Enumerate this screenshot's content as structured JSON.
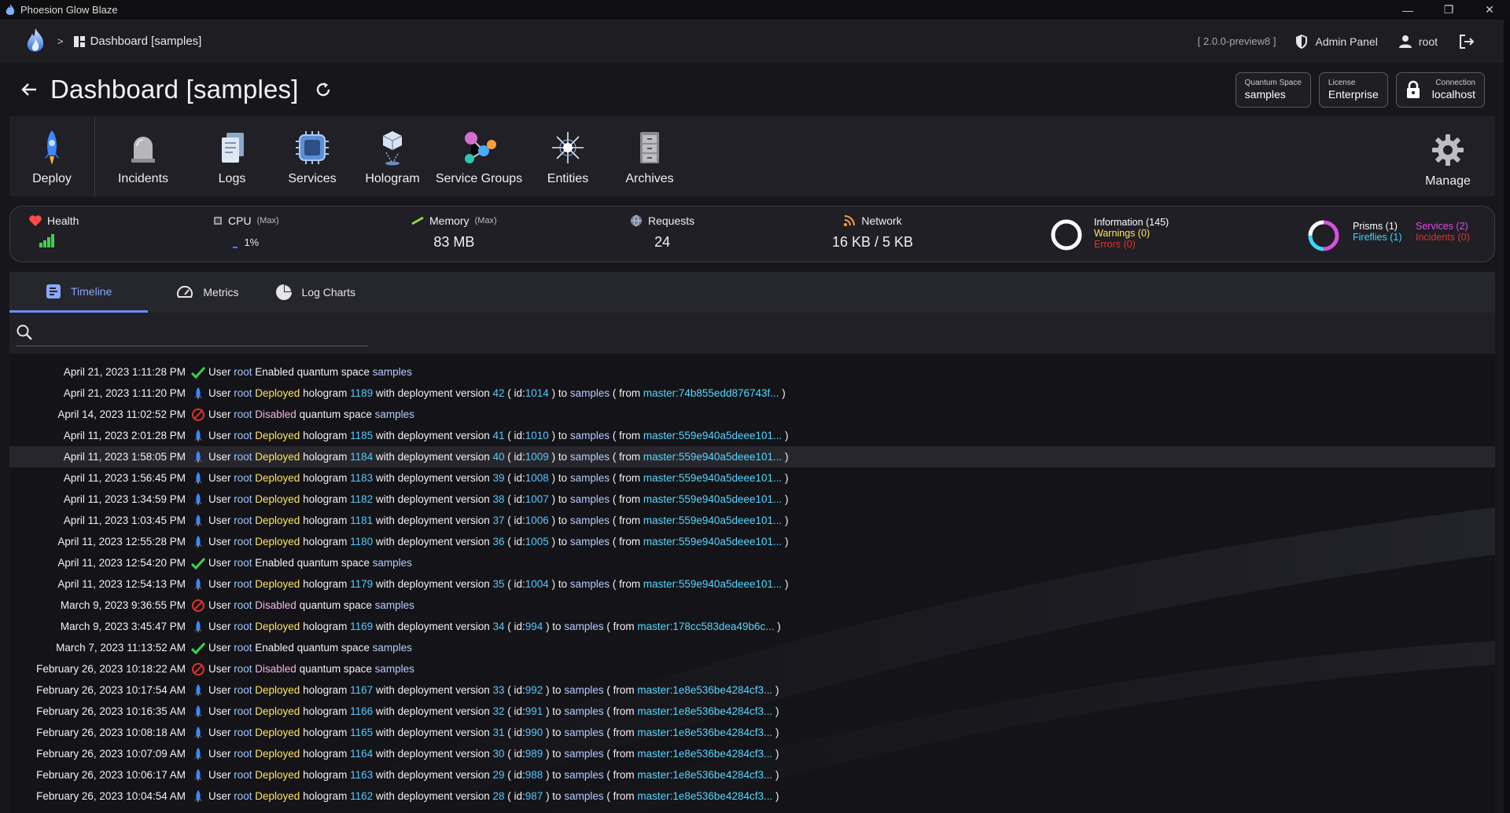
{
  "window": {
    "title": "Phoesion Glow Blaze",
    "minimize": "—",
    "maximize": "❐",
    "close": "✕"
  },
  "topnav": {
    "breadcrumb_sep": ">",
    "breadcrumb": "Dashboard [samples]",
    "version": "[ 2.0.0-preview8 ]",
    "admin_panel": "Admin Panel",
    "user": "root"
  },
  "header": {
    "title": "Dashboard [samples]",
    "chips": {
      "quantum_space_label": "Quantum Space",
      "quantum_space_value": "samples",
      "license_label": "License",
      "license_value": "Enterprise",
      "connection_label": "Connection",
      "connection_value": "localhost"
    }
  },
  "toolbar": {
    "items": [
      "Deploy",
      "Incidents",
      "Logs",
      "Services",
      "Hologram",
      "Service Groups",
      "Entities",
      "Archives"
    ],
    "manage": "Manage"
  },
  "status": {
    "health_label": "Health",
    "cpu_label": "CPU",
    "cpu_sub": "(Max)",
    "cpu_value": "1%",
    "memory_label": "Memory",
    "memory_sub": "(Max)",
    "memory_value": "83 MB",
    "requests_label": "Requests",
    "requests_value": "24",
    "network_label": "Network",
    "network_value": "16 KB / 5 KB",
    "information": "Information (145)",
    "warnings": "Warnings (0)",
    "errors": "Errors (0)",
    "prisms": "Prisms (1)",
    "fireflies": "Fireflies (1)",
    "services": "Services (2)",
    "incidents": "Incidents (0)",
    "colors": {
      "info": "#ffffff",
      "warning": "#ffe45c",
      "error": "#e0302a",
      "prisms": "#ffffff",
      "fireflies": "#3fd6ff",
      "services": "#d84fe0",
      "incidents": "#e0302a"
    }
  },
  "tabs": {
    "timeline": "Timeline",
    "metrics": "Metrics",
    "log_charts": "Log Charts"
  },
  "search": {
    "placeholder": "",
    "value": ""
  },
  "timeline": [
    {
      "time": "April 21, 2023 1:11:28 PM",
      "kind": "enabled"
    },
    {
      "time": "April 21, 2023 1:11:20 PM",
      "kind": "deploy",
      "hologram": "1189",
      "version": "42",
      "id": "1014",
      "master": "master:74b855edd876743f..."
    },
    {
      "time": "April 14, 2023 11:02:52 PM",
      "kind": "disabled"
    },
    {
      "time": "April 11, 2023 2:01:28 PM",
      "kind": "deploy",
      "hologram": "1185",
      "version": "41",
      "id": "1010",
      "master": "master:559e940a5deee101..."
    },
    {
      "time": "April 11, 2023 1:58:05 PM",
      "kind": "deploy",
      "hologram": "1184",
      "version": "40",
      "id": "1009",
      "master": "master:559e940a5deee101..."
    },
    {
      "time": "April 11, 2023 1:56:45 PM",
      "kind": "deploy",
      "hologram": "1183",
      "version": "39",
      "id": "1008",
      "master": "master:559e940a5deee101..."
    },
    {
      "time": "April 11, 2023 1:34:59 PM",
      "kind": "deploy",
      "hologram": "1182",
      "version": "38",
      "id": "1007",
      "master": "master:559e940a5deee101..."
    },
    {
      "time": "April 11, 2023 1:03:45 PM",
      "kind": "deploy",
      "hologram": "1181",
      "version": "37",
      "id": "1006",
      "master": "master:559e940a5deee101..."
    },
    {
      "time": "April 11, 2023 12:55:28 PM",
      "kind": "deploy",
      "hologram": "1180",
      "version": "36",
      "id": "1005",
      "master": "master:559e940a5deee101..."
    },
    {
      "time": "April 11, 2023 12:54:20 PM",
      "kind": "enabled"
    },
    {
      "time": "April 11, 2023 12:54:13 PM",
      "kind": "deploy",
      "hologram": "1179",
      "version": "35",
      "id": "1004",
      "master": "master:559e940a5deee101..."
    },
    {
      "time": "March 9, 2023 9:36:55 PM",
      "kind": "disabled"
    },
    {
      "time": "March 9, 2023 3:45:47 PM",
      "kind": "deploy",
      "hologram": "1169",
      "version": "34",
      "id": "994",
      "master": "master:178cc583dea49b6c..."
    },
    {
      "time": "March 7, 2023 11:13:52 AM",
      "kind": "enabled"
    },
    {
      "time": "February 26, 2023 10:18:22 AM",
      "kind": "disabled"
    },
    {
      "time": "February 26, 2023 10:17:54 AM",
      "kind": "deploy",
      "hologram": "1167",
      "version": "33",
      "id": "992",
      "master": "master:1e8e536be4284cf3..."
    },
    {
      "time": "February 26, 2023 10:16:35 AM",
      "kind": "deploy",
      "hologram": "1166",
      "version": "32",
      "id": "991",
      "master": "master:1e8e536be4284cf3..."
    },
    {
      "time": "February 26, 2023 10:08:18 AM",
      "kind": "deploy",
      "hologram": "1165",
      "version": "31",
      "id": "990",
      "master": "master:1e8e536be4284cf3..."
    },
    {
      "time": "February 26, 2023 10:07:09 AM",
      "kind": "deploy",
      "hologram": "1164",
      "version": "30",
      "id": "989",
      "master": "master:1e8e536be4284cf3..."
    },
    {
      "time": "February 26, 2023 10:06:17 AM",
      "kind": "deploy",
      "hologram": "1163",
      "version": "29",
      "id": "988",
      "master": "master:1e8e536be4284cf3..."
    },
    {
      "time": "February 26, 2023 10:04:54 AM",
      "kind": "deploy",
      "hologram": "1162",
      "version": "28",
      "id": "987",
      "master": "master:1e8e536be4284cf3..."
    }
  ],
  "timeline_words": {
    "user": "User",
    "root": "root",
    "enabled": "Enabled",
    "disabled": "Disabled",
    "deployed": "Deployed",
    "quantum_space": "quantum space",
    "samples": "samples",
    "hologram": "hologram",
    "with_version": "with deployment version",
    "id_open": "( id:",
    "id_close": ") to",
    "from_open": "( from",
    "from_close": ")"
  }
}
